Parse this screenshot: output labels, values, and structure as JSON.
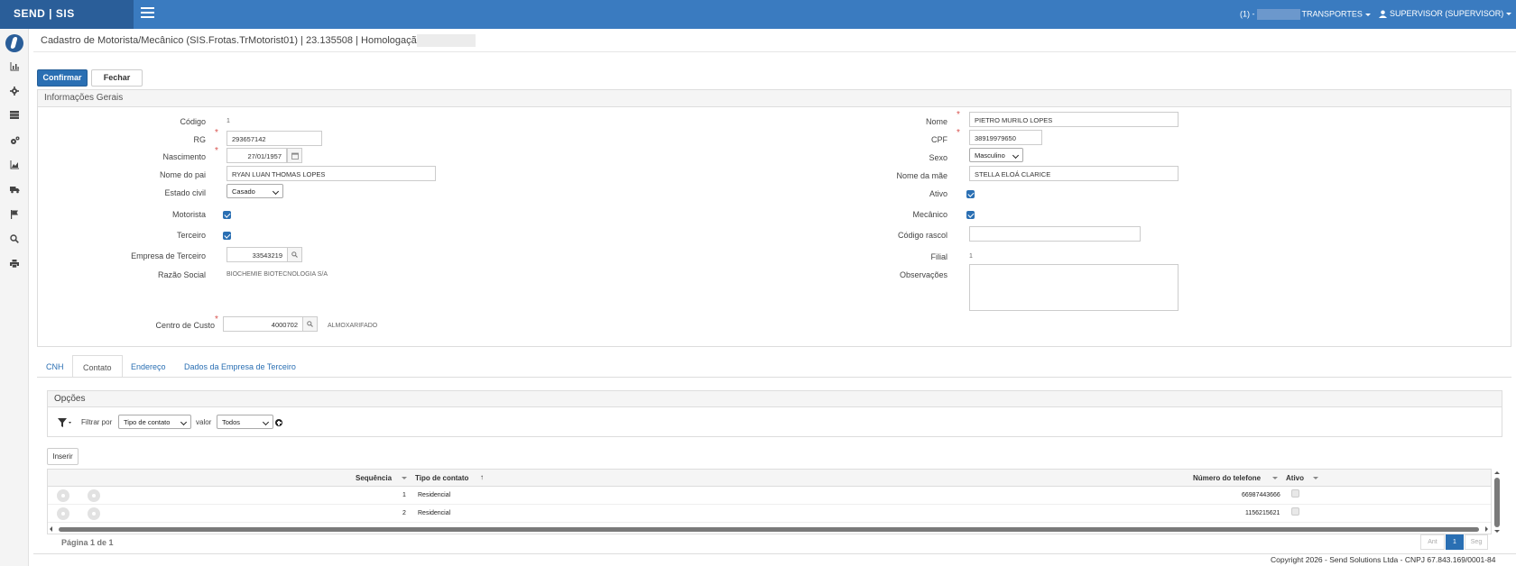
{
  "app": {
    "brand": "SEND | SIS"
  },
  "topbar": {
    "company_prefix": "(1) -",
    "company_suffix": "TRANSPORTES",
    "user": "SUPERVISOR (SUPERVISOR)"
  },
  "page": {
    "title": "Cadastro de Motorista/Mecânico (SIS.Frotas.TrMotorist01) | 23.135508 | Homologação |"
  },
  "toolbar": {
    "confirm_label": "Confirmar",
    "close_label": "Fechar"
  },
  "form": {
    "section_title": "Informações Gerais",
    "codigo": {
      "label": "Código",
      "value": "1"
    },
    "rg": {
      "label": "RG",
      "value": "293657142"
    },
    "nascimento": {
      "label": "Nascimento",
      "value": "27/01/1957"
    },
    "nome_pai": {
      "label": "Nome do pai",
      "value": "RYAN LUAN THOMAS LOPES"
    },
    "estado_civil": {
      "label": "Estado civil",
      "value": "Casado"
    },
    "motorista": {
      "label": "Motorista",
      "checked": true
    },
    "terceiro": {
      "label": "Terceiro",
      "checked": true
    },
    "empresa_terceiro": {
      "label": "Empresa de Terceiro",
      "value": "33543219"
    },
    "razao_social": {
      "label": "Razão Social",
      "value": "BIOCHEMIE BIOTECNOLOGIA S/A"
    },
    "centro_custo": {
      "label": "Centro de Custo",
      "value": "4000702",
      "description": "ALMOXARIFADO"
    },
    "nome": {
      "label": "Nome",
      "value": "PIETRO MURILO LOPES"
    },
    "cpf": {
      "label": "CPF",
      "value": "38919979650"
    },
    "sexo": {
      "label": "Sexo",
      "value": "Masculino"
    },
    "nome_mae": {
      "label": "Nome da mãe",
      "value": "STELLA ELOÁ CLARICE"
    },
    "ativo": {
      "label": "Ativo",
      "checked": true
    },
    "mecanico": {
      "label": "Mecânico",
      "checked": true
    },
    "codigo_rascol": {
      "label": "Código rascol",
      "value": ""
    },
    "filial": {
      "label": "Filial",
      "value": "1"
    },
    "observacoes": {
      "label": "Observações",
      "value": ""
    }
  },
  "tabs": [
    {
      "label": "CNH",
      "active": false
    },
    {
      "label": "Contato",
      "active": true
    },
    {
      "label": "Endereço",
      "active": false
    },
    {
      "label": "Dados da Empresa de Terceiro",
      "active": false
    }
  ],
  "options": {
    "title": "Opções",
    "filter_by_label": "Filtrar por",
    "filter_field": "Tipo de contato",
    "value_label": "valor",
    "filter_value": "Todos"
  },
  "grid": {
    "insert_label": "Inserir",
    "columns": {
      "seq": "Sequência",
      "tipo": "Tipo de contato",
      "numero": "Número do telefone",
      "ativo": "Ativo"
    },
    "sort_arrow": "↑",
    "rows": [
      {
        "seq": "1",
        "tipo": "Residencial",
        "numero": "66987443666"
      },
      {
        "seq": "2",
        "tipo": "Residencial",
        "numero": "1156215621"
      }
    ]
  },
  "pager": {
    "info": "Página 1 de 1",
    "prev": "Ant",
    "current": "1",
    "next": "Seg"
  },
  "footer": {
    "text": "Copyright 2026 - Send Solutions Ltda - CNPJ 67.843.169/0001-84"
  },
  "colors": {
    "topbar": "#3a7bc0",
    "brand_bg": "#2a5e99",
    "primary": "#2a6fb3",
    "required": "#d9534f"
  }
}
